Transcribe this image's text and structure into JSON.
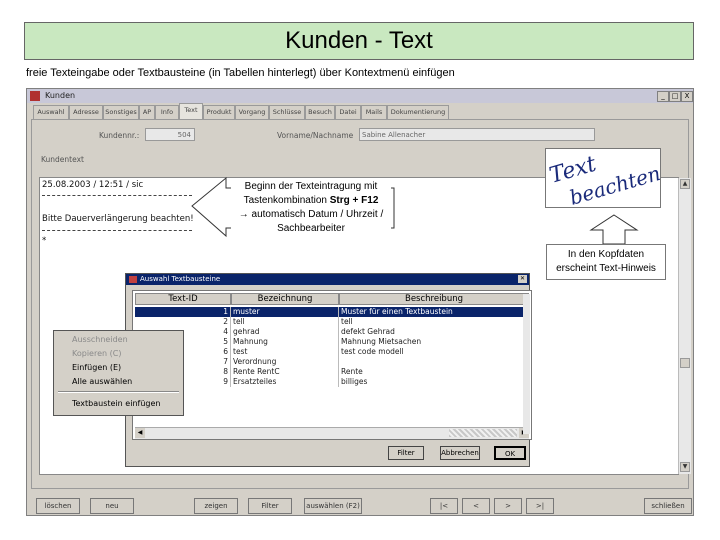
{
  "slide": {
    "title": "Kunden - Text",
    "subtitle": "freie Texteingabe oder Textbausteine (in Tabellen hinterlegt) über Kontextmenü einfügen"
  },
  "window": {
    "title": "Kunden",
    "controls": [
      "_",
      "□",
      "X"
    ],
    "tabs": [
      "Auswahl",
      "Adresse",
      "Sonstiges",
      "AP",
      "Info",
      "Text",
      "Produkt",
      "Vorgang",
      "Schlüsse",
      "Besuch",
      "Datei",
      "Mails",
      "Dokumentierung"
    ],
    "active_tab": "Text",
    "fields": {
      "kundennr_label": "Kundennr.:",
      "kundennr_value": "504",
      "name_label": "Vorname/Nachname",
      "name_value": "Sabine Allenacher"
    },
    "text_section_label": "Kundentext",
    "text_lines": [
      "25.08.2003 / 12:51 / sic",
      "Bitte Dauerverlängerung beachten!",
      "*"
    ],
    "bottom_buttons": [
      "löschen",
      "neu",
      "zeigen",
      "Filter",
      "auswählen (F2)",
      "|<",
      "<",
      ">",
      ">|",
      "schließen"
    ]
  },
  "callout": {
    "line1": "Beginn der Texteintragung mit",
    "line2_prefix": "Tastenkombination ",
    "line2_bold": "Strg + F12",
    "line3": "→ automatisch Datum / Uhrzeit /",
    "line4": "Sachbearbeiter"
  },
  "stamp": {
    "word1": "Text",
    "word2": "beachten",
    "color": "#1a2a7a"
  },
  "hint": {
    "line1": "In den Kopfdaten",
    "line2": "erscheint Text-Hinweis"
  },
  "dialog": {
    "title": "Auswahl Textbausteine",
    "columns": [
      "Text-ID",
      "Bezeichnung",
      "Beschreibung"
    ],
    "rows": [
      {
        "id": "1",
        "bez": "muster",
        "desc": "Muster für einen Textbaustein",
        "selected": true
      },
      {
        "id": "2",
        "bez": "tell",
        "desc": "tell",
        "selected": false
      },
      {
        "id": "4",
        "bez": "gehrad",
        "desc": "defekt Gehrad",
        "selected": false
      },
      {
        "id": "5",
        "bez": "Mahnung",
        "desc": "Mahnung Mietsachen",
        "selected": false
      },
      {
        "id": "6",
        "bez": "test",
        "desc": "test code modell",
        "selected": false
      },
      {
        "id": "7",
        "bez": "Verordnung",
        "desc": "",
        "selected": false
      },
      {
        "id": "8",
        "bez": "Rente RentC",
        "desc": "Rente",
        "selected": false
      },
      {
        "id": "9",
        "bez": "Ersatzteiles",
        "desc": "billiges",
        "selected": false
      }
    ],
    "buttons": [
      "Filter",
      "Abbrechen",
      "OK"
    ]
  },
  "context_menu": {
    "items": [
      {
        "label": "Ausschneiden",
        "disabled": true
      },
      {
        "label": "Kopieren (C)",
        "disabled": true
      },
      {
        "label": "Einfügen (E)",
        "disabled": false
      },
      {
        "label": "Alle auswählen",
        "disabled": false
      }
    ],
    "last_item": "Textbaustein einfügen"
  },
  "colors": {
    "title_bg": "#c9e8c0",
    "selection": "#0a246a",
    "window_bg": "#d4d0c8"
  }
}
